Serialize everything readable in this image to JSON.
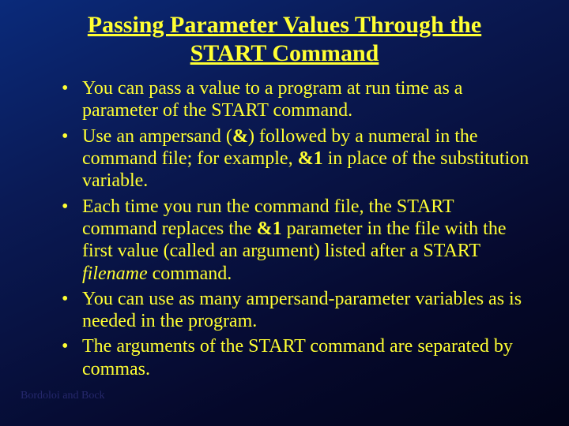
{
  "title": "Passing Parameter Values Through the START Command",
  "bullets": {
    "b1": "You can pass a value to a program at run time as a parameter of the START command.",
    "b2a": "Use an ampersand (",
    "b2amp": "&",
    "b2b": ") followed by a numeral in the command file; for example, ",
    "b2c": "&1",
    "b2d": " in place of the substitution variable.",
    "b3a": " Each time you run the command file, the START command replaces the ",
    "b3b": "&1",
    "b3c": " parameter in the file with the first value (called an argument) listed after a START ",
    "b3d": "filename",
    "b3e": " command.",
    "b4": "You can use as many ampersand-parameter variables as is needed in the program.",
    "b5": "The arguments of the START command are separated by commas."
  },
  "footer": "Bordoloi and Bock"
}
